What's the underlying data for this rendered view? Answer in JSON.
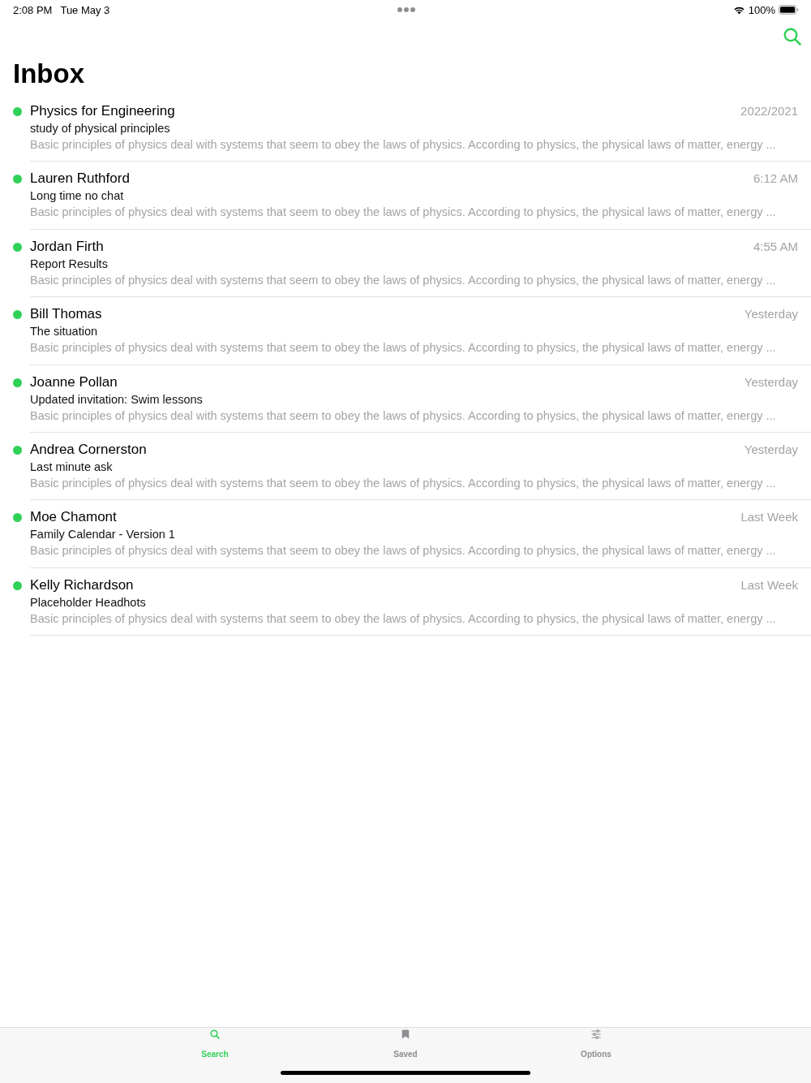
{
  "status_bar": {
    "time": "2:08 PM",
    "date": "Tue May 3",
    "battery": "100%"
  },
  "nav": {
    "title": "Inbox"
  },
  "messages": [
    {
      "sender": "Physics for Engineering",
      "subject": "study of physical principles",
      "preview": "Basic principles of physics deal with systems that seem to obey the laws of physics. According to physics, the physical laws of matter, energy ...",
      "date": "2022/2021",
      "unread": true
    },
    {
      "sender": "Lauren Ruthford",
      "subject": "Long time no chat",
      "preview": "Basic principles of physics deal with systems that seem to obey the laws of physics. According to physics, the physical laws of matter, energy ...",
      "date": "6:12 AM",
      "unread": true
    },
    {
      "sender": "Jordan Firth",
      "subject": "Report Results",
      "preview": "Basic principles of physics deal with systems that seem to obey the laws of physics. According to physics, the physical laws of matter, energy ...",
      "date": "4:55 AM",
      "unread": true
    },
    {
      "sender": "Bill Thomas",
      "subject": "The situation",
      "preview": "Basic principles of physics deal with systems that seem to obey the laws of physics. According to physics, the physical laws of matter, energy ...",
      "date": "Yesterday",
      "unread": true
    },
    {
      "sender": "Joanne Pollan",
      "subject": "Updated invitation: Swim lessons",
      "preview": "Basic principles of physics deal with systems that seem to obey the laws of physics. According to physics, the physical laws of matter, energy ...",
      "date": "Yesterday",
      "unread": true
    },
    {
      "sender": "Andrea Cornerston",
      "subject": "Last minute ask",
      "preview": "Basic principles of physics deal with systems that seem to obey the laws of physics. According to physics, the physical laws of matter, energy ...",
      "date": "Yesterday",
      "unread": true
    },
    {
      "sender": "Moe Chamont",
      "subject": "Family Calendar - Version 1",
      "preview": "Basic principles of physics deal with systems that seem to obey the laws of physics. According to physics, the physical laws of matter, energy ...",
      "date": "Last Week",
      "unread": true
    },
    {
      "sender": "Kelly Richardson",
      "subject": "Placeholder Headhots",
      "preview": "Basic principles of physics deal with systems that seem to obey the laws of physics. According to physics, the physical laws of matter, energy ...",
      "date": "Last Week",
      "unread": true
    }
  ],
  "tab_bar": {
    "tabs": [
      {
        "label": "Search",
        "kind": "search",
        "selected": true
      },
      {
        "label": "Saved",
        "kind": "bookmark",
        "selected": false
      },
      {
        "label": "Options",
        "kind": "options",
        "selected": false
      }
    ]
  }
}
